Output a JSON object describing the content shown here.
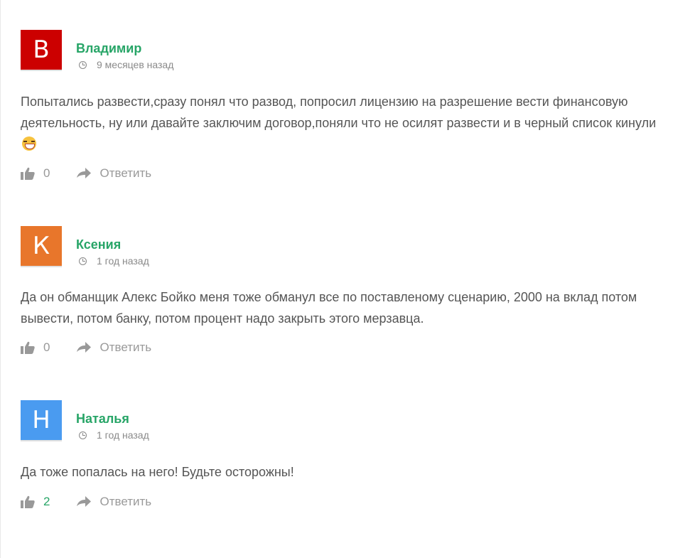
{
  "comments": [
    {
      "avatar_letter": "В",
      "avatar_color": "#cc0000",
      "author": "Владимир",
      "time": "9 месяцев назад",
      "text": "Попытались развести,сразу понял что развод, попросил лицензию на разрешение вести финансовую деятельность, ну или давайте заключим договор,поняли что не осилят развести и в черный список кинули",
      "emoji": "laughing-with-tears-emoji",
      "likes": "0",
      "reply_label": "Ответить"
    },
    {
      "avatar_letter": "К",
      "avatar_color": "#e8762b",
      "author": "Ксения",
      "time": "1 год назад",
      "text": "Да он обманщик Алекс Бойко меня тоже обманул все по поставленому сценарию, 2000 на вклад потом вывести, потом банку, потом процент надо закрыть этого мерзавца.",
      "likes": "0",
      "reply_label": "Ответить"
    },
    {
      "avatar_letter": "Н",
      "avatar_color": "#4a9bf0",
      "author": "Наталья",
      "time": "1 год назад",
      "text": "Да тоже попалась на него! Будьте осторожны!",
      "likes": "2",
      "reply_label": "Ответить"
    }
  ],
  "colors": {
    "author": "#27a567",
    "meta": "#8a8a8a",
    "text": "#555555",
    "action": "#999999"
  }
}
